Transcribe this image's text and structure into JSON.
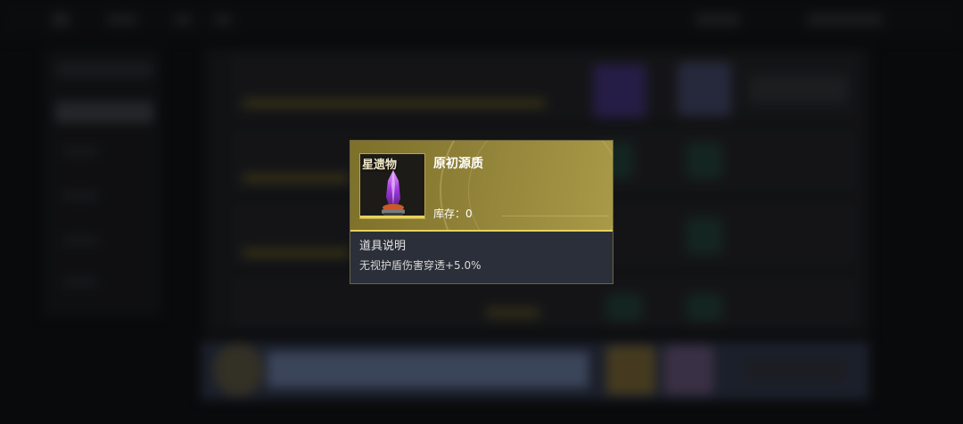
{
  "item": {
    "category_tag": "星遗物",
    "name": "原初源质",
    "stock_label": "库存：",
    "stock_value": "0",
    "image_icon": "purple-crystal-icon",
    "rarity_color": "#e7d25c"
  },
  "description": {
    "title": "道具说明",
    "text": "无视护盾伤害穿透+5.0%"
  }
}
